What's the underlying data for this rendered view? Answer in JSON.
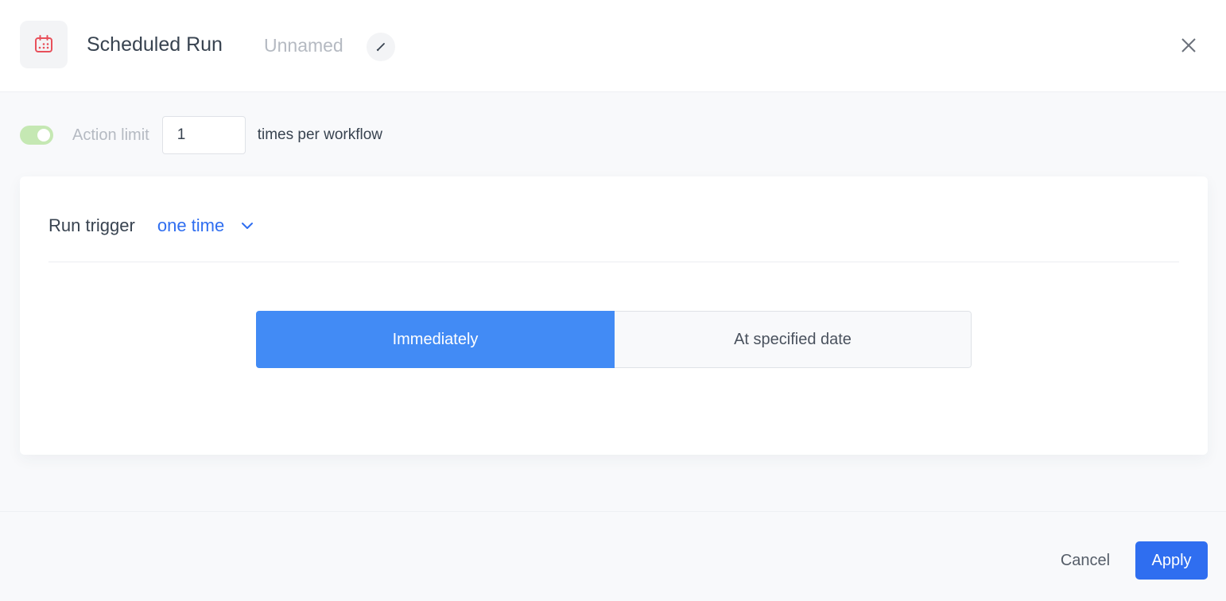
{
  "header": {
    "icon": "calendar-icon",
    "title": "Scheduled Run",
    "subtitle": "Unnamed",
    "edit_icon": "pencil-icon",
    "close_icon": "close-icon"
  },
  "action_limit": {
    "enabled": true,
    "label": "Action limit",
    "value": "1",
    "suffix": "times per workflow"
  },
  "trigger": {
    "label": "Run trigger",
    "selected": "one time",
    "options": [
      {
        "label": "Immediately",
        "active": true
      },
      {
        "label": "At specified date",
        "active": false
      }
    ]
  },
  "footer": {
    "cancel_label": "Cancel",
    "apply_label": "Apply"
  },
  "colors": {
    "accent": "#2f6ef0",
    "segment_active": "#428bf5",
    "toggle_on": "#c5e8b3",
    "calendar_icon": "#e8505b"
  }
}
